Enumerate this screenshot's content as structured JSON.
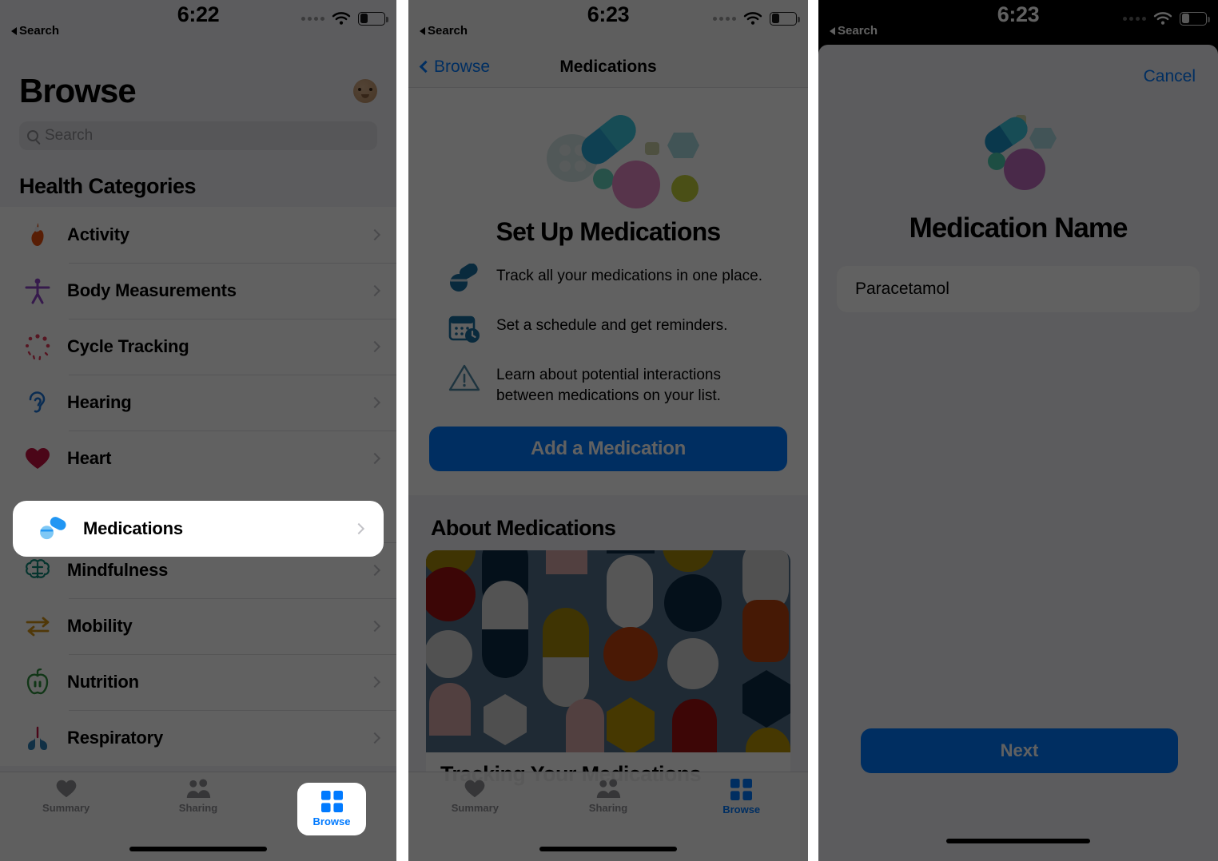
{
  "panel1": {
    "status": {
      "time": "6:22",
      "back_label": "Search",
      "wifi": "wifi-icon",
      "battery": "battery-icon"
    },
    "title": "Browse",
    "avatar": "memoji-avatar",
    "search": {
      "placeholder": "Search",
      "value": ""
    },
    "section_header": "Health Categories",
    "categories": [
      {
        "label": "Activity",
        "icon": "flame-icon",
        "color": "#e8500e"
      },
      {
        "label": "Body Measurements",
        "icon": "body-icon",
        "color": "#8e44c9"
      },
      {
        "label": "Cycle Tracking",
        "icon": "cycle-icon",
        "color": "#e23b5a"
      },
      {
        "label": "Hearing",
        "icon": "ear-icon",
        "color": "#1b74d8"
      },
      {
        "label": "Heart",
        "icon": "heart-icon",
        "color": "#c4123f"
      },
      {
        "label": "Medications",
        "icon": "pills-icon",
        "color": "#2196f3"
      },
      {
        "label": "Mindfulness",
        "icon": "brain-icon",
        "color": "#0f8a7a"
      },
      {
        "label": "Mobility",
        "icon": "arrows-icon",
        "color": "#d39417"
      },
      {
        "label": "Nutrition",
        "icon": "apple-icon",
        "color": "#2f8f3d"
      },
      {
        "label": "Respiratory",
        "icon": "lungs-icon",
        "color": "#2f7fb5"
      }
    ],
    "highlight_index": 5,
    "tabs": [
      {
        "label": "Summary",
        "icon": "heart-icon",
        "active": false
      },
      {
        "label": "Sharing",
        "icon": "people-icon",
        "active": false
      },
      {
        "label": "Browse",
        "icon": "grid-icon",
        "active": true
      }
    ]
  },
  "panel2": {
    "status": {
      "time": "6:23",
      "back_label": "Search"
    },
    "nav": {
      "back_label": "Browse",
      "title": "Medications"
    },
    "hero": {
      "artwork": "medication-pills-illustration",
      "heading": "Set Up Medications",
      "features": [
        {
          "icon": "pills-icon",
          "text": "Track all your medications in one place."
        },
        {
          "icon": "calendar-clock-icon",
          "text": "Set a schedule and get reminders."
        },
        {
          "icon": "warning-triangle-icon",
          "text": "Learn about potential interactions between medications on your list."
        }
      ],
      "cta_label": "Add a Medication"
    },
    "about": {
      "header": "About Medications",
      "card_image": "pill-pattern-artwork",
      "card_caption": "Tracking Your Medications"
    },
    "tabs": [
      {
        "label": "Summary",
        "icon": "heart-icon",
        "active": false
      },
      {
        "label": "Sharing",
        "icon": "people-icon",
        "active": false
      },
      {
        "label": "Browse",
        "icon": "grid-icon",
        "active": true
      }
    ]
  },
  "panel3": {
    "status": {
      "time": "6:23",
      "back_label": "Search"
    },
    "cancel_label": "Cancel",
    "artwork": "medication-pills-illustration",
    "heading": "Medication Name",
    "name_field": {
      "value": "Paracetamol",
      "placeholder": "Medication Name"
    },
    "next_label": "Next"
  },
  "colors": {
    "accent": "#007aff",
    "dim": "rgba(0,0,0,0.62)",
    "page_bg": "#f2f2f7"
  }
}
